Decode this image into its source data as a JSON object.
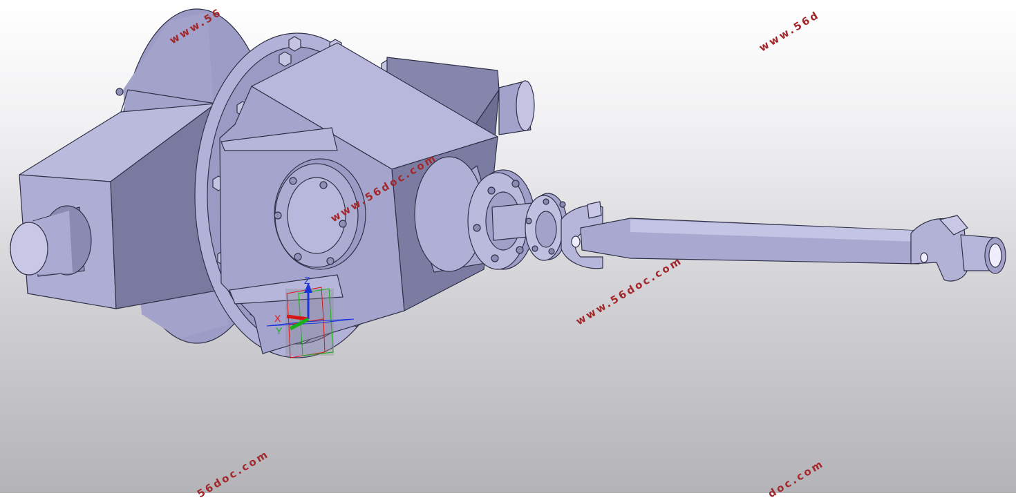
{
  "viewport": {
    "watermarks": [
      {
        "text": "www.56doc.com",
        "visible": "www.56"
      },
      {
        "text": "www.56doc.com",
        "visible": "www.56d"
      },
      {
        "text": "www.56doc.com",
        "visible": "www.56doc.com"
      },
      {
        "text": "www.56doc.com",
        "visible": "www.56doc.com"
      },
      {
        "text": "www.56doc.com",
        "visible": "56doc.com"
      },
      {
        "text": "www.56doc.com",
        "visible": "doc.com"
      }
    ]
  },
  "compass": {
    "x_label": "X",
    "y_label": "Y",
    "z_label": "Z",
    "colors": {
      "x": "#d81818",
      "y": "#18b018",
      "z": "#1a34d8"
    }
  },
  "model": {
    "parts": [
      "differential-housing",
      "output-shaft-left",
      "output-shaft-right",
      "flange-yoke",
      "drive-shaft",
      "universal-joint"
    ],
    "colors": {
      "face": "#a6a6cc",
      "dark": "#77779c",
      "shade": "#8a8ab2",
      "edge": "#303048"
    }
  }
}
